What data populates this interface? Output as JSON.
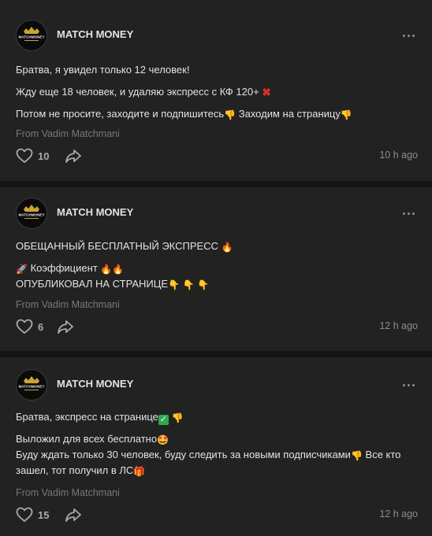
{
  "posts": [
    {
      "author": "MATCH MONEY",
      "lines": [
        "Братва, я увидел только 12 человек!",
        "Жду еще 18 человек, и удаляю экспресс с КФ 120+",
        "Потом не просите, заходите и подпишитесь",
        "Заходим на страницу"
      ],
      "from": "From Vadim Matchmani",
      "likes": "10",
      "time": "10 h ago"
    },
    {
      "author": "MATCH MONEY",
      "lines": [
        "ОБЕЩАННЫЙ БЕСПЛАТНЫЙ ЭКСПРЕСС",
        "Коэффициент",
        "ОПУБЛИКОВАЛ НА СТРАНИЦЕ"
      ],
      "from": "From Vadim Matchmani",
      "likes": "6",
      "time": "12 h ago"
    },
    {
      "author": "MATCH MONEY",
      "lines": [
        "Братва, экспресс на странице",
        "Выложил для всех бесплатно",
        "Буду ждать только 30 человек, буду следить за новыми подписчиками",
        "Все кто зашел, тот получил в ЛС"
      ],
      "from": "From Vadim Matchmani",
      "likes": "15",
      "time": "12 h ago"
    }
  ],
  "avatar": {
    "logo_text": "MATCHMONEY"
  },
  "icons": {
    "more": "more-horizontal-icon",
    "like": "heart-icon",
    "share": "share-arrow-icon",
    "finger": "point-down-emoji",
    "fire": "fire-emoji",
    "rocket": "rocket-emoji",
    "cross": "cross-mark-emoji",
    "check": "check-mark-emoji",
    "star_eyes": "star-struck-emoji",
    "gift": "gift-emoji"
  },
  "colors": {
    "background": "#141414",
    "card": "#222222",
    "text": "#e1e3e6",
    "muted": "#76787a"
  }
}
